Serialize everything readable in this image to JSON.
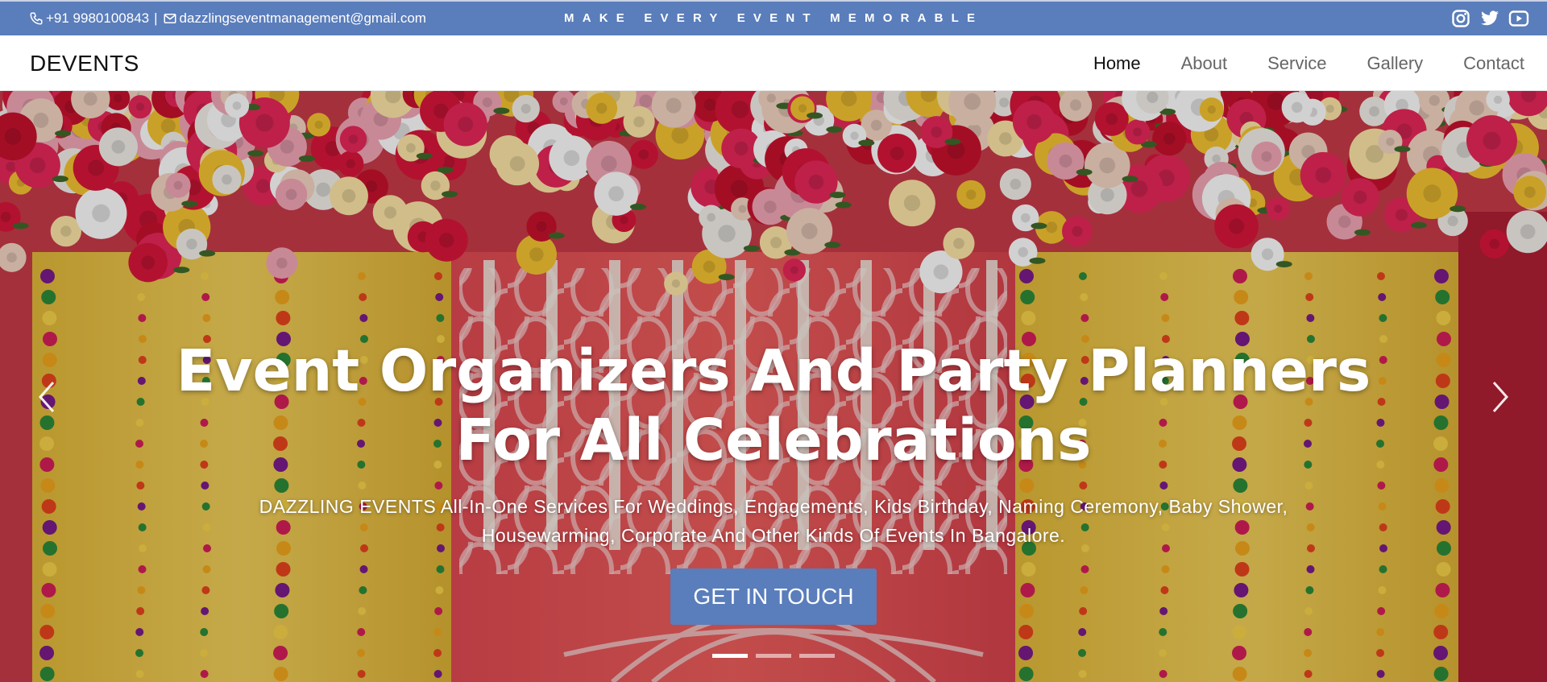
{
  "topbar": {
    "phone": "+91 9980100843",
    "separator": "|",
    "email": "dazzlingseventmanagement@gmail.com",
    "tagline": "MAKE EVERY EVENT MEMORABLE",
    "socials": [
      "instagram-icon",
      "twitter-icon",
      "youtube-icon"
    ],
    "background_color": "#5a7dbb"
  },
  "navbar": {
    "brand": "DEVENTS",
    "items": [
      {
        "label": "Home",
        "active": true
      },
      {
        "label": "About",
        "active": false
      },
      {
        "label": "Service",
        "active": false
      },
      {
        "label": "Gallery",
        "active": false
      },
      {
        "label": "Contact",
        "active": false
      }
    ]
  },
  "hero": {
    "title_line1": "Event Organizers And Party Planners",
    "title_line2": "For All Celebrations",
    "subtitle": "DAZZLING EVENTS All-In-One Services For Weddings, Engagements, Kids Birthday, Naming Ceremony, Baby Shower, Housewarming, Corporate And Other Kinds Of Events In Bangalore.",
    "cta_label": "GET IN TOUCH",
    "cta_color": "#5a7dbb",
    "carousel": {
      "slides": 3,
      "active_index": 0
    },
    "controls": [
      "chevron-left-icon",
      "chevron-right-icon"
    ]
  }
}
